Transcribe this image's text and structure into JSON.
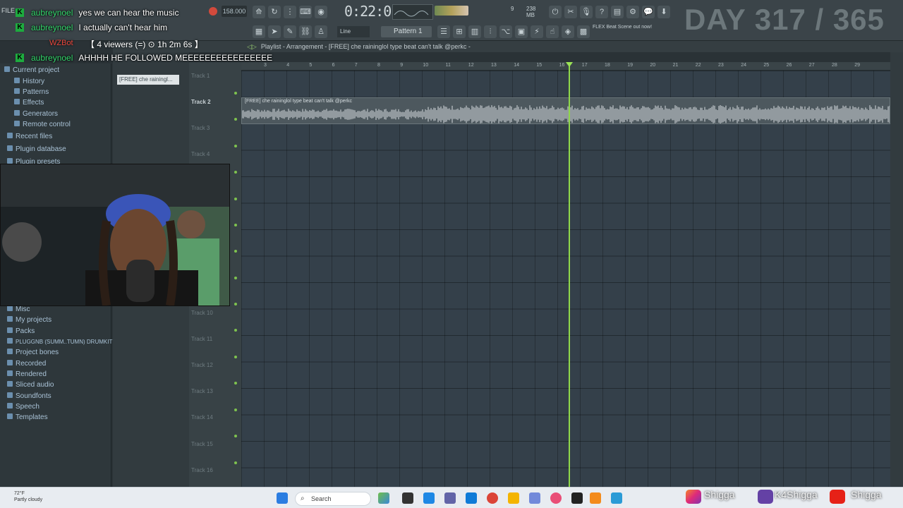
{
  "app": {
    "menu_file": "FILE",
    "tempo": "158.000",
    "time": "0:22:01",
    "pattern": "Pattern 1",
    "snap": "Line",
    "cpu_top": "9",
    "mem": "238 MB",
    "news": "FLEX Beat Scene out now!",
    "day_counter": "DAY 317 / 365"
  },
  "playlist": {
    "title": "Playlist - Arrangement - [FREE] che  raininglol type beat can't talk @perkc -",
    "pattern_clip": "[FREE] che  rainingl...",
    "clip_label": "[FREE] che  raininglol type beat can't talk @perkc",
    "tracks": [
      {
        "name": "Track 1"
      },
      {
        "name": "Track 2"
      },
      {
        "name": "Track 3"
      },
      {
        "name": "Track 4"
      },
      {
        "name": "Track 10"
      },
      {
        "name": "Track 11"
      },
      {
        "name": "Track 12"
      },
      {
        "name": "Track 13"
      },
      {
        "name": "Track 14"
      },
      {
        "name": "Track 15"
      },
      {
        "name": "Track 16"
      }
    ],
    "ruler": [
      "3",
      "4",
      "5",
      "6",
      "7",
      "8",
      "9",
      "10",
      "11",
      "12",
      "13",
      "14",
      "15",
      "16",
      "17",
      "18",
      "19",
      "20",
      "21",
      "22",
      "23",
      "24",
      "25",
      "26",
      "27",
      "28",
      "29"
    ]
  },
  "browser": {
    "items": [
      {
        "label": "Current project"
      },
      {
        "label": "History"
      },
      {
        "label": "Patterns"
      },
      {
        "label": "Effects"
      },
      {
        "label": "Generators"
      },
      {
        "label": "Remote control"
      },
      {
        "label": "Recent files"
      },
      {
        "label": "Plugin database"
      },
      {
        "label": "Plugin presets"
      },
      {
        "label": "Misc"
      },
      {
        "label": "My projects"
      },
      {
        "label": "Packs"
      },
      {
        "label": "PLUGGNB (SUMM..TUMN) DRUMKIT"
      },
      {
        "label": "Project bones"
      },
      {
        "label": "Recorded"
      },
      {
        "label": "Rendered"
      },
      {
        "label": "Sliced audio"
      },
      {
        "label": "Soundfonts"
      },
      {
        "label": "Speech"
      },
      {
        "label": "Templates"
      }
    ]
  },
  "chat": {
    "lines": [
      {
        "user": "aubreynoel",
        "message": "yes we can hear the music"
      },
      {
        "user": "aubreynoel",
        "message": "I actually can't hear him"
      },
      {
        "user": "aubreynoel",
        "message": "AHHHH HE FOLLOWED MEEEEEEEEEEEEEEEE"
      }
    ],
    "viewers_text": "【 4 viewers (=) ⊙ 1h 2m 6s 】",
    "viewer_user": "WZBot"
  },
  "taskbar": {
    "weather_temp": "72°F",
    "weather_desc": "Partly cloudy",
    "search": "Search"
  },
  "socials": {
    "instagram": "Shigga",
    "twitch": "K4Shigga",
    "youtube": "Shigga"
  },
  "colors": {
    "playhead": "#8fd84a",
    "chat_user": "#35d96e",
    "grid_bg": "#34404a"
  }
}
